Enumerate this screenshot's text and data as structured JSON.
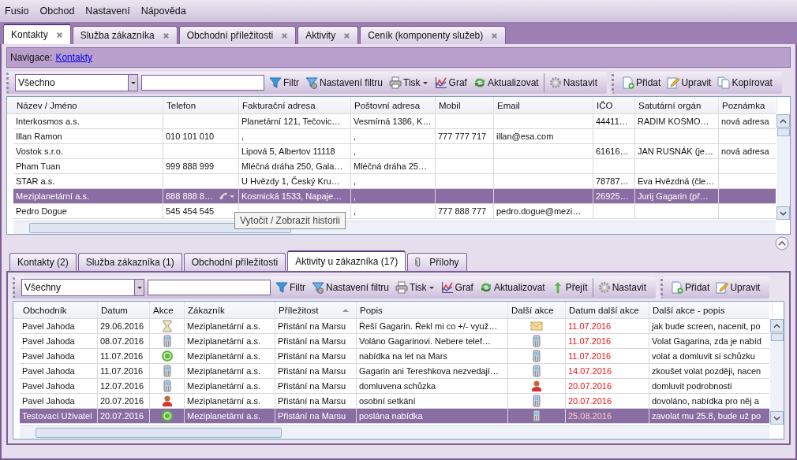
{
  "menu": [
    "Fusio",
    "Obchod",
    "Nastavení",
    "Nápověda"
  ],
  "tabs": [
    {
      "label": "Kontakty",
      "selected": true
    },
    {
      "label": "Služba zákazníka",
      "selected": false
    },
    {
      "label": "Obchodní příležitosti",
      "selected": false
    },
    {
      "label": "Aktivity",
      "selected": false
    },
    {
      "label": "Ceník (komponenty služeb)",
      "selected": false
    }
  ],
  "navigation": {
    "label": "Navigace:",
    "link": "Kontakty"
  },
  "contacts": {
    "toolbar": {
      "combo": "Všechno",
      "buttons": [
        {
          "label": "Filtr",
          "kind": "filter"
        },
        {
          "label": "Nastavení filtru",
          "kind": "filter-settings"
        },
        {
          "label": "Tisk",
          "kind": "print"
        },
        {
          "label": "Graf",
          "kind": "chart"
        },
        {
          "label": "Aktualizovat",
          "kind": "refresh"
        },
        {
          "label": "Nastavit",
          "kind": "gear"
        }
      ],
      "actions": [
        {
          "label": "Přidat",
          "kind": "new"
        },
        {
          "label": "Upravit",
          "kind": "edit"
        },
        {
          "label": "Kopírovat",
          "kind": "copy"
        }
      ]
    },
    "table": {
      "columns": [
        {
          "label": "Název / Jméno"
        },
        {
          "label": "Telefon"
        },
        {
          "label": "Fakturační adresa"
        },
        {
          "label": "Poštovní adresa"
        },
        {
          "label": "Mobil"
        },
        {
          "label": "Email"
        },
        {
          "label": "IČO"
        },
        {
          "label": "Satutární orgán"
        },
        {
          "label": "Poznámka"
        }
      ],
      "rows": [
        {
          "selected": false,
          "cells": [
            "Interkosmos a.s.",
            null,
            "Planetární 121, Tečovic…",
            "Vesmírná 1386, K…",
            null,
            null,
            "44411…",
            "RADIM KOSMO…",
            "nová adresa"
          ]
        },
        {
          "selected": false,
          "cells": [
            "Illan Ramon",
            "010 101 010",
            ",",
            ",",
            "777 777 717",
            "illan@esa.com",
            null,
            null,
            null
          ]
        },
        {
          "selected": false,
          "cells": [
            "Vostok s.r.o.",
            null,
            "Lipová 5, Albertov 11118",
            ",",
            null,
            null,
            "61616…",
            "JAN RUSNÁK (je…",
            "nová adresa"
          ]
        },
        {
          "selected": false,
          "cells": [
            "Pham Tuan",
            "999 888 999",
            "Mléčná dráha 250, Gala…",
            "Mléčná dráha 25…",
            null,
            null,
            null,
            null,
            null
          ]
        },
        {
          "selected": false,
          "cells": [
            "STAR a.s.",
            null,
            "U Hvězdy 1, Český Kru…",
            ",",
            null,
            null,
            "78787…",
            "Eva Hvězdná (čle…",
            null
          ]
        },
        {
          "selected": true,
          "cells": [
            "Meziplanetární a.s.",
            "888 888 8…",
            "Kosmická 1533, Napaje…",
            ",",
            null,
            null,
            "26925…",
            "Jurij Gagarin (př…",
            null
          ]
        },
        {
          "selected": false,
          "cells": [
            "Pedro Dogue",
            "545 454 545",
            null,
            ",",
            "777 888 777",
            "pedro.dogue@mezi…",
            null,
            null,
            null
          ]
        }
      ]
    },
    "tooltip": "Vytočit / Zobrazit historii"
  },
  "detail_tabs": [
    {
      "label": "Kontakty (2)",
      "selected": false,
      "kind": "plain"
    },
    {
      "label": "Služba zákazníka (1)",
      "selected": false,
      "kind": "plain"
    },
    {
      "label": "Obchodní příležitosti",
      "selected": false,
      "kind": "plain"
    },
    {
      "label": "Aktivity u zákazníka (17)",
      "selected": true,
      "kind": "plain"
    },
    {
      "label": "Přílohy",
      "selected": false,
      "kind": "attachments"
    }
  ],
  "activities": {
    "toolbar": {
      "combo": "Všechny",
      "buttons": [
        {
          "label": "Filtr",
          "kind": "filter"
        },
        {
          "label": "Nastavení filtru",
          "kind": "filter-settings"
        },
        {
          "label": "Tisk",
          "kind": "print"
        },
        {
          "label": "Graf",
          "kind": "chart"
        },
        {
          "label": "Aktualizovat",
          "kind": "refresh"
        },
        {
          "label": "Přejít",
          "kind": "go"
        },
        {
          "label": "Nastavit",
          "kind": "gear"
        }
      ],
      "actions": [
        {
          "label": "Přidat",
          "kind": "new"
        },
        {
          "label": "Upravit",
          "kind": "edit"
        }
      ]
    },
    "table": {
      "columns": [
        {
          "label": "Obchodník"
        },
        {
          "label": "Datum"
        },
        {
          "label": "Akce"
        },
        {
          "label": "Zákazník"
        },
        {
          "label": "Příležitost",
          "sorted_ascending": true
        },
        {
          "label": "Popis"
        },
        {
          "label": "Další akce"
        },
        {
          "label": "Datum další akce",
          "kind": "due"
        },
        {
          "label": "Další akce - popis"
        }
      ],
      "rows": [
        {
          "selected": false,
          "cells": [
            "Pavel Jahoda",
            "29.06.2016",
            {
              "kind": "hourglass"
            },
            "Meziplanetární a.s.",
            "Přistání na Marsu",
            "Řeší Gagarin. Řekl mi co +/- využ…",
            {
              "kind": "mail"
            },
            "11.07.2016",
            "jak bude screen, nacenit, po"
          ]
        },
        {
          "selected": false,
          "cells": [
            "Pavel Jahoda",
            "08.07.2016",
            {
              "kind": "phone"
            },
            "Meziplanetární a.s.",
            "Přistání na Marsu",
            "Voláno Gagarinovi. Nebere telef…",
            {
              "kind": "phone"
            },
            "11.07.2016",
            "Volat Gagarina, zda je nabíd"
          ]
        },
        {
          "selected": false,
          "cells": [
            "Pavel Jahoda",
            "11.07.2016",
            {
              "kind": "money"
            },
            "Meziplanetární a.s.",
            "Přistání na Marsu",
            "nabídka na let na Mars",
            {
              "kind": "phone"
            },
            "11.07.2016",
            "volat a domluvit si schůzku"
          ]
        },
        {
          "selected": false,
          "cells": [
            "Pavel Jahoda",
            "11.07.2016",
            {
              "kind": "phone"
            },
            "Meziplanetární a.s.",
            "Přistání na Marsu",
            "Gagarin ani Tereshkova nezvedají…",
            {
              "kind": "phone"
            },
            "14.07.2016",
            "zkoušet volat později, nacen"
          ]
        },
        {
          "selected": false,
          "cells": [
            "Pavel Jahoda",
            "12.07.2016",
            {
              "kind": "phone"
            },
            "Meziplanetární a.s.",
            "Přistání na Marsu",
            "domluvena schůzka",
            {
              "kind": "person"
            },
            "20.07.2016",
            "domluvit podrobnosti"
          ]
        },
        {
          "selected": false,
          "cells": [
            "Pavel Jahoda",
            "20.07.2016",
            {
              "kind": "person"
            },
            "Meziplanetární a.s.",
            "Přistání na Marsu",
            "osobní setkání",
            {
              "kind": "phone"
            },
            "20.07.2016",
            "dovoláno, nabídka pro něj a"
          ]
        },
        {
          "selected": true,
          "cells": [
            "Testovací Uživatel",
            "20.07.2016",
            {
              "kind": "money"
            },
            "Meziplanetární a.s.",
            "Přistání na Marsu",
            "poslána nabídka",
            {
              "kind": "phone"
            },
            "25.08.2016",
            "zavolat mu 25.8, bude už po"
          ]
        }
      ]
    }
  }
}
